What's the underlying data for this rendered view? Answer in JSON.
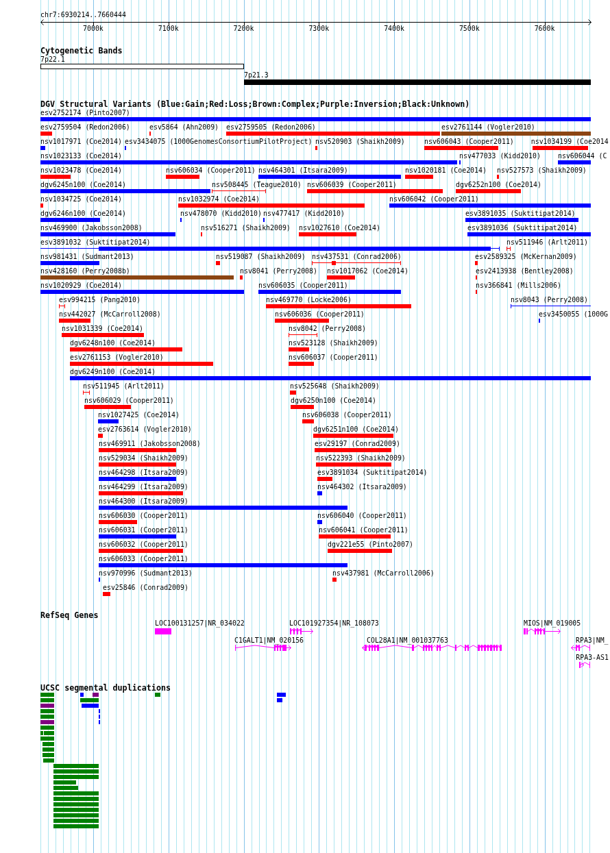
{
  "ruler": {
    "region": "chr7:6930214..7660444",
    "ticks": [
      "7000k",
      "7100k",
      "7200k",
      "7300k",
      "7400k",
      "7500k",
      "7600k"
    ]
  },
  "cytogenetic_bands": {
    "title": "Cytogenetic Bands",
    "bands": [
      {
        "label": "7p22.1",
        "color": "#ffffff"
      },
      {
        "label": "7p21.3",
        "color": "#000000"
      }
    ]
  },
  "dgv_variants": {
    "title": "DGV Structural Variants (Blue:Gain;Red:Loss;Brown:Complex;Purple:Inversion;Black:Unknown)",
    "rows": [
      {
        "features": [
          {
            "label": "esv2752174 (Pinto2007)",
            "color": "#0000ff"
          }
        ]
      },
      {
        "features": [
          {
            "label": "esv2759504 (Redon2006)",
            "color": "#ff0000"
          },
          {
            "label": "esv5864 (Ahn2009)",
            "color": "#ff0000"
          },
          {
            "label": "esv2759505 (Redon2006)",
            "color": "#ff0000"
          },
          {
            "label": "esv2761144 (Vogler2010)",
            "color": "#8b4513"
          }
        ]
      },
      {
        "features": [
          {
            "label": "nsv1017971 (Coe2014)",
            "color": "#0000ff"
          },
          {
            "label": "esv3434075 (1000GenomesConsortiumPilotProject)",
            "color": "#0000ff"
          },
          {
            "label": "nsv520903 (Shaikh2009)",
            "color": "#ff0000"
          },
          {
            "label": "nsv606043 (Cooper2011)",
            "color": "#ff0000"
          },
          {
            "label": "nsv1034199 (Coe2014",
            "color": "#ff0000"
          }
        ]
      },
      {
        "features": [
          {
            "label": "nsv1023133 (Coe2014)",
            "color": "#0000ff"
          },
          {
            "label": "nsv477033 (Kidd2010)",
            "color": "#0000ff"
          },
          {
            "label": "nsv606044 (C",
            "color": "#0000ff"
          }
        ]
      },
      {
        "features": [
          {
            "label": "nsv1023478 (Coe2014)",
            "color": "#ff0000"
          },
          {
            "label": "nsv606034 (Cooper2011)",
            "color": "#ff0000"
          },
          {
            "label": "nsv464301 (Itsara2009)",
            "color": "#0000ff"
          },
          {
            "label": "nsv1020181 (Coe2014)",
            "color": "#ff0000"
          },
          {
            "label": "nsv527573 (Shaikh2009)",
            "color": "#ff0000"
          }
        ]
      },
      {
        "features": [
          {
            "label": "dgv6245n100 (Coe2014)",
            "color": "#0000ff"
          },
          {
            "label": "nsv508445 (Teague2010)",
            "color": "#ff0000"
          },
          {
            "label": "nsv606039 (Cooper2011)",
            "color": "#ff0000"
          },
          {
            "label": "dgv6252n100 (Coe2014)",
            "color": "#ff0000"
          }
        ]
      },
      {
        "features": [
          {
            "label": "nsv1034725 (Coe2014)",
            "color": "#ff0000"
          },
          {
            "label": "nsv1032974 (Coe2014)",
            "color": "#ff0000"
          },
          {
            "label": "nsv606042 (Cooper2011)",
            "color": "#0000ff"
          }
        ]
      },
      {
        "features": [
          {
            "label": "dgv6246n100 (Coe2014)",
            "color": "#0000ff"
          },
          {
            "label": "nsv478070 (Kidd2010)",
            "color": "#0000ff"
          },
          {
            "label": "nsv477417 (Kidd2010)",
            "color": "#0000ff"
          },
          {
            "label": "esv3891035 (Suktitipat2014)",
            "color": "#0000ff"
          }
        ]
      },
      {
        "features": [
          {
            "label": "nsv469900 (Jakobsson2008)",
            "color": "#0000ff"
          },
          {
            "label": "nsv516271 (Shaikh2009)",
            "color": "#ff0000"
          },
          {
            "label": "nsv1027610 (Coe2014)",
            "color": "#ff0000"
          },
          {
            "label": "esv3891036 (Suktitipat2014)",
            "color": "#0000ff"
          }
        ]
      },
      {
        "features": [
          {
            "label": "esv3891032 (Suktitipat2014)",
            "color": "#0000ff"
          },
          {
            "label": "nsv511946 (Arlt2011)",
            "color": "#ff0000"
          }
        ]
      },
      {
        "features": [
          {
            "label": "nsv981431 (Sudmant2013)",
            "color": "#0000ff"
          },
          {
            "label": "nsv519087 (Shaikh2009)",
            "color": "#ff0000"
          },
          {
            "label": "nsv437531 (Conrad2006)",
            "color": "#ff0000"
          },
          {
            "label": "esv2589325 (McKernan2009)",
            "color": "#ff0000"
          }
        ]
      },
      {
        "features": [
          {
            "label": "nsv428160 (Perry2008b)",
            "color": "#8b4513"
          },
          {
            "label": "nsv8041 (Perry2008)",
            "color": "#ff0000"
          },
          {
            "label": "nsv1017062 (Coe2014)",
            "color": "#ff0000"
          },
          {
            "label": "esv2413938 (Bentley2008)",
            "color": "#ff0000"
          }
        ]
      },
      {
        "features": [
          {
            "label": "nsv1020929 (Coe2014)",
            "color": "#0000ff"
          },
          {
            "label": "nsv606035 (Cooper2011)",
            "color": "#0000ff"
          },
          {
            "label": "nsv366841 (Mills2006)",
            "color": "#ff0000"
          }
        ]
      },
      {
        "features": [
          {
            "label": "esv994215 (Pang2010)",
            "color": "#ff0000"
          },
          {
            "label": "nsv469770 (Locke2006)",
            "color": "#ff0000"
          },
          {
            "label": "nsv8043 (Perry2008)",
            "color": "#0000ff"
          }
        ]
      },
      {
        "features": [
          {
            "label": "nsv442027 (McCarroll2008)",
            "color": "#ff0000"
          },
          {
            "label": "nsv606036 (Cooper2011)",
            "color": "#ff0000"
          },
          {
            "label": "esv3450055 (1000G",
            "color": "#0000ff"
          }
        ]
      },
      {
        "features": [
          {
            "label": "nsv1031339 (Coe2014)",
            "color": "#ff0000"
          },
          {
            "label": "nsv8042 (Perry2008)",
            "color": "#ff0000"
          }
        ]
      },
      {
        "features": [
          {
            "label": "dgv6248n100 (Coe2014)",
            "color": "#ff0000"
          },
          {
            "label": "nsv523128 (Shaikh2009)",
            "color": "#ff0000"
          }
        ]
      },
      {
        "features": [
          {
            "label": "esv2761153 (Vogler2010)",
            "color": "#ff0000"
          },
          {
            "label": "nsv606037 (Cooper2011)",
            "color": "#ff0000"
          }
        ]
      },
      {
        "features": [
          {
            "label": "dgv6249n100 (Coe2014)",
            "color": "#0000ff"
          }
        ]
      },
      {
        "features": [
          {
            "label": "nsv511945 (Arlt2011)",
            "color": "#ff0000"
          },
          {
            "label": "nsv525648 (Shaikh2009)",
            "color": "#ff0000"
          }
        ]
      },
      {
        "features": [
          {
            "label": "nsv606029 (Cooper2011)",
            "color": "#ff0000"
          },
          {
            "label": "dgv6250n100 (Coe2014)",
            "color": "#ff0000"
          }
        ]
      },
      {
        "features": [
          {
            "label": "nsv1027425 (Coe2014)",
            "color": "#0000ff"
          },
          {
            "label": "nsv606038 (Cooper2011)",
            "color": "#ff0000"
          }
        ]
      },
      {
        "features": [
          {
            "label": "esv2763614 (Vogler2010)",
            "color": "#ff0000"
          },
          {
            "label": "dgv6251n100 (Coe2014)",
            "color": "#ff0000"
          }
        ]
      },
      {
        "features": [
          {
            "label": "nsv469911 (Jakobsson2008)",
            "color": "#ff0000"
          },
          {
            "label": "esv29197 (Conrad2009)",
            "color": "#ff0000"
          }
        ]
      },
      {
        "features": [
          {
            "label": "nsv529034 (Shaikh2009)",
            "color": "#ff0000"
          },
          {
            "label": "nsv522393 (Shaikh2009)",
            "color": "#ff0000"
          }
        ]
      },
      {
        "features": [
          {
            "label": "nsv464298 (Itsara2009)",
            "color": "#0000ff"
          },
          {
            "label": "esv3891034 (Suktitipat2014)",
            "color": "#ff0000"
          }
        ]
      },
      {
        "features": [
          {
            "label": "nsv464299 (Itsara2009)",
            "color": "#ff0000"
          },
          {
            "label": "nsv464302 (Itsara2009)",
            "color": "#0000ff"
          }
        ]
      },
      {
        "features": [
          {
            "label": "nsv464300 (Itsara2009)",
            "color": "#0000ff"
          }
        ]
      },
      {
        "features": [
          {
            "label": "nsv606030 (Cooper2011)",
            "color": "#ff0000"
          },
          {
            "label": "nsv606040 (Cooper2011)",
            "color": "#0000ff"
          }
        ]
      },
      {
        "features": [
          {
            "label": "nsv606031 (Cooper2011)",
            "color": "#0000ff"
          },
          {
            "label": "nsv606041 (Cooper2011)",
            "color": "#ff0000"
          }
        ]
      },
      {
        "features": [
          {
            "label": "nsv606032 (Cooper2011)",
            "color": "#ff0000"
          },
          {
            "label": "dgv221e55 (Pinto2007)",
            "color": "#ff0000"
          }
        ]
      },
      {
        "features": [
          {
            "label": "nsv606033 (Cooper2011)",
            "color": "#0000ff"
          }
        ]
      },
      {
        "features": [
          {
            "label": "nsv970996 (Sudmant2013)",
            "color": "#0000ff"
          },
          {
            "label": "nsv437981 (McCarroll2006)",
            "color": "#ff0000"
          }
        ]
      },
      {
        "features": [
          {
            "label": "esv25846 (Conrad2009)",
            "color": "#ff0000"
          }
        ]
      }
    ]
  },
  "refseq_genes": {
    "title": "RefSeq Genes",
    "genes": [
      {
        "label": "LOC100131257|NR_034022"
      },
      {
        "label": "LOC101927354|NR_108073"
      },
      {
        "label": "C1GALT1|NM_020156"
      },
      {
        "label": "COL28A1|NM_001037763"
      },
      {
        "label": "MIOS|NM_019005"
      },
      {
        "label": "RPA3|NM_"
      },
      {
        "label": "RPA3-AS1"
      }
    ]
  },
  "segmental_duplications": {
    "title": "UCSC segmental duplications",
    "rows": [
      {
        "items": [
          {
            "color": "#008000"
          },
          {
            "color": "#0000ff"
          },
          {
            "color": "#800080"
          },
          {
            "color": "#008000"
          },
          {
            "color": "#0000ff"
          }
        ]
      },
      {
        "items": [
          {
            "color": "#008000"
          },
          {
            "color": "#008000"
          },
          {
            "color": "#0000ff"
          }
        ]
      },
      {
        "items": [
          {
            "color": "#800080"
          },
          {
            "color": "#0000ff"
          }
        ]
      },
      {
        "items": [
          {
            "color": "#008000"
          },
          {
            "color": "#0000ff"
          }
        ]
      },
      {
        "items": [
          {
            "color": "#008000"
          },
          {
            "color": "#0000ff"
          }
        ]
      },
      {
        "items": [
          {
            "color": "#800080"
          },
          {
            "color": "#0000ff"
          }
        ]
      },
      {
        "items": [
          {
            "color": "#008000"
          }
        ]
      },
      {
        "items": [
          {
            "color": "#008000"
          },
          {
            "color": "#008000"
          }
        ]
      },
      {
        "items": [
          {
            "color": "#008000"
          }
        ]
      },
      {
        "items": [
          {
            "color": "#008000"
          }
        ]
      },
      {
        "items": [
          {
            "color": "#008000"
          }
        ]
      },
      {
        "items": [
          {
            "color": "#008000"
          }
        ]
      },
      {
        "items": [
          {
            "color": "#008000"
          }
        ]
      },
      {
        "items": [
          {
            "color": "#008000"
          }
        ]
      },
      {
        "items": [
          {
            "color": "#008000"
          }
        ]
      },
      {
        "items": [
          {
            "color": "#008000"
          }
        ]
      },
      {
        "items": [
          {
            "color": "#008000"
          }
        ]
      },
      {
        "items": [
          {
            "color": "#008000"
          }
        ]
      },
      {
        "items": [
          {
            "color": "#008000"
          }
        ]
      },
      {
        "items": [
          {
            "color": "#008000"
          }
        ]
      },
      {
        "items": [
          {
            "color": "#008000"
          }
        ]
      },
      {
        "items": [
          {
            "color": "#008000"
          }
        ]
      },
      {
        "items": [
          {
            "color": "#008000"
          }
        ]
      },
      {
        "items": [
          {
            "color": "#008000"
          }
        ]
      },
      {
        "items": [
          {
            "color": "#008000"
          }
        ]
      }
    ]
  }
}
